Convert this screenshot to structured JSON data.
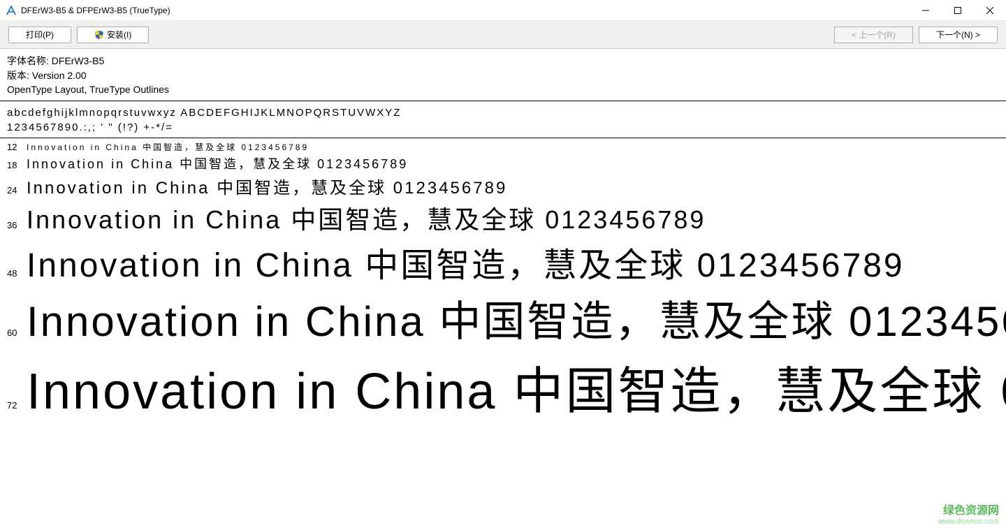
{
  "window": {
    "title": "DFErW3-B5 & DFPErW3-B5  (TrueType)"
  },
  "toolbar": {
    "print_label": "打印(P)",
    "install_label": "安装(I)",
    "prev_label": "< 上一个(R)",
    "next_label": "下一个(N) >"
  },
  "font_info": {
    "name_label": "字体名称: DFErW3-B5",
    "version_label": "版本: Version 2.00",
    "layout_label": "OpenType Layout, TrueType Outlines"
  },
  "charset": {
    "line1": "abcdefghijklmnopqrstuvwxyz ABCDEFGHIJKLMNOPQRSTUVWXYZ",
    "line2": "1234567890.:,; ' \" (!?) +-*/="
  },
  "sample_text": "Innovation in China 中国智造，慧及全球 0123456789",
  "sample_sizes": [
    12,
    18,
    24,
    36,
    48,
    60,
    72
  ],
  "watermark": {
    "main": "绿色资源网",
    "sub": "www.downcc.com"
  }
}
